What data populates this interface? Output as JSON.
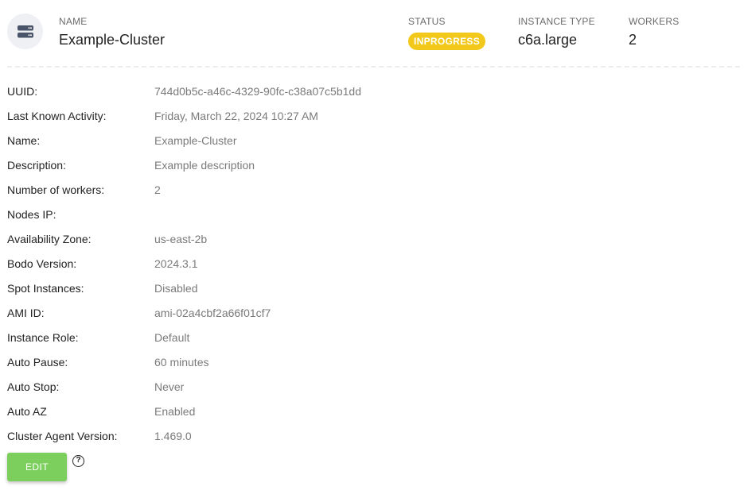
{
  "header": {
    "name_label": "NAME",
    "name_value": "Example-Cluster",
    "status_label": "STATUS",
    "status_value": "INPROGRESS",
    "instance_type_label": "INSTANCE TYPE",
    "instance_type_value": "c6a.large",
    "workers_label": "WORKERS",
    "workers_value": "2",
    "avatar_icon": "server-icon",
    "status_color": "#f2c81a"
  },
  "details": [
    {
      "key": "UUID:",
      "value": "744d0b5c-a46c-4329-90fc-c38a07c5b1dd"
    },
    {
      "key": "Last Known Activity:",
      "value": "Friday, March 22, 2024 10:27 AM"
    },
    {
      "key": "Name:",
      "value": "Example-Cluster"
    },
    {
      "key": "Description:",
      "value": "Example description"
    },
    {
      "key": "Number of workers:",
      "value": "2"
    },
    {
      "key": "Nodes IP:",
      "value": ""
    },
    {
      "key": "Availability Zone:",
      "value": "us-east-2b"
    },
    {
      "key": "Bodo Version:",
      "value": "2024.3.1"
    },
    {
      "key": "Spot Instances:",
      "value": "Disabled"
    },
    {
      "key": "AMI ID:",
      "value": "ami-02a4cbf2a66f01cf7"
    },
    {
      "key": "Instance Role:",
      "value": "Default"
    },
    {
      "key": "Auto Pause:",
      "value": "60 minutes"
    },
    {
      "key": "Auto Stop:",
      "value": "Never"
    },
    {
      "key": "Auto AZ",
      "value": "Enabled"
    },
    {
      "key": "Cluster Agent Version:",
      "value": "1.469.0"
    }
  ],
  "actions": {
    "edit_label": "EDIT",
    "help_glyph": "?",
    "edit_color": "#7ccf5d"
  }
}
